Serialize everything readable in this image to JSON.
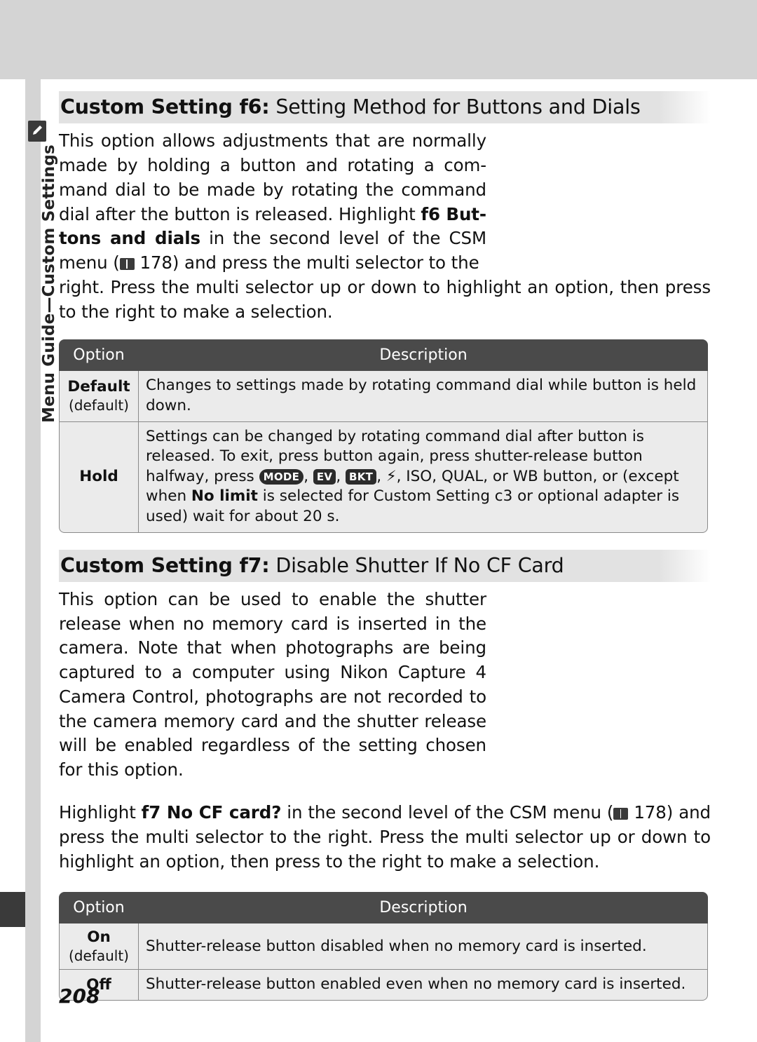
{
  "page": {
    "number": "208",
    "side_tab_text": "Menu Guide—Custom Settings"
  },
  "sections": [
    {
      "id": "f6",
      "title_bold": "Custom Setting f6:",
      "title_light": " Setting Method for Buttons and Dials",
      "paragraphs": [
        "This option allows adjustments that are normally made by holding a button and rotating a command dial to be made by rotating the command dial after the button is released.  Highlight f6 Buttons and dials in the second level of the CSM menu ( 178) and press the multi selector to the right.  Press the multi selector up or down to highlight an option, then press to the right to make a selection."
      ],
      "table": {
        "headers": [
          "Option",
          "Description"
        ],
        "rows": [
          {
            "option_main": "Default",
            "option_sub": "(default)",
            "description": "Changes to settings made by rotating command dial while button is held down."
          },
          {
            "option_main": "Hold",
            "option_sub": "",
            "description": "Settings can be changed by rotating command dial after button is released.  To exit, press button again, press shutter-release button halfway, press MODE, EV, BKT, flash, ISO, QUAL, or WB button, or (except when No limit is selected for Custom Setting c3 or optional adapter is used) wait for about 20 s."
          }
        ]
      }
    },
    {
      "id": "f7",
      "title_bold": "Custom Setting f7:",
      "title_light": " Disable Shutter If No CF Card",
      "paragraphs": [
        "This option can be used to enable the shutter release when no memory card is inserted in the camera.  Note that when photographs are being captured to a computer using Nikon Capture 4 Camera Control, photographs are not recorded to the camera memory card and the shutter release will be enabled regardless of the setting chosen for this option.",
        "Highlight f7 No CF card? in the second level of the CSM menu ( 178) and press the multi selector to the right.  Press the multi selector up or down to highlight an option, then press to the right to make a selection."
      ],
      "table": {
        "headers": [
          "Option",
          "Description"
        ],
        "rows": [
          {
            "option_main": "On",
            "option_sub": "(default)",
            "description": "Shutter-release button disabled when no memory card is inserted."
          },
          {
            "option_main": "Off",
            "option_sub": "",
            "description": "Shutter-release button enabled even when no memory card is inserted."
          }
        ]
      }
    }
  ],
  "inline": {
    "f6_p1_a": "This option allows adjustments that are normally made by holding a button and rotating a com-mand dial to be made by rotating the command dial after the button is released.  Highlight ",
    "f6_bold1": "f6 But-tons and dials",
    "f6_p1_b": " in the second level of the CSM menu (",
    "f6_ref1": " 178) and press the multi selector to the right.  Press the multi selector up or down to highlight an option, then press to the right to make a selection.",
    "f7_p2_a": "Highlight ",
    "f7_bold1": "f7 No CF card?",
    "f7_p2_b": " in the second level of the CSM menu (",
    "f7_ref1": " 178) and press the multi selector to the right.  Press the multi selector up or down to highlight an option, then press to the right to make a selection.",
    "hold_a": "Settings can be changed by rotating command dial after button is released.  To exit, press button again, press shutter-release button halfway, press ",
    "hold_badge_mode": "MODE",
    "hold_b": ", ",
    "hold_badge_ev": "EV",
    "hold_c": ", ",
    "hold_badge_bkt": "BKT",
    "hold_d": ", ",
    "hold_e": ", ISO, QUAL, or WB button, or (except when ",
    "hold_bold_nolimit": "No limit",
    "hold_f": " is selected for Custom Setting c3 or optional adapter is used) wait for about 20 s."
  }
}
